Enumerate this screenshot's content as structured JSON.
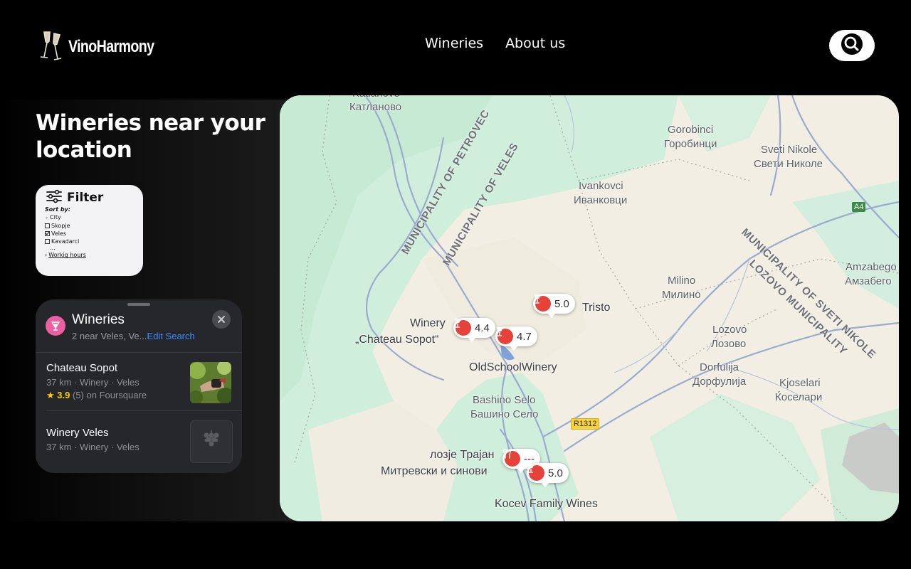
{
  "brand": {
    "name": "VinoHarmony"
  },
  "nav": {
    "items": [
      "Wineries",
      "About us"
    ]
  },
  "page": {
    "title": "Wineries near your location"
  },
  "filter": {
    "title": "Filter",
    "sort_by": "Sort by:",
    "city_label": "City",
    "cities": [
      {
        "name": "Skopje",
        "checked": false
      },
      {
        "name": "Veles",
        "checked": true
      },
      {
        "name": "Kavadarci",
        "checked": false
      }
    ],
    "ellipsis": "...",
    "hours_label": "Workig hours"
  },
  "wineries_panel": {
    "title": "Wineries",
    "subtitle": "2 near Veles, Ve...",
    "edit_label": "Edit Search",
    "results": [
      {
        "name": "Chateau Sopot",
        "meta": "37 km · Winery · Veles",
        "rating": "3.9",
        "rating_count": "(5)",
        "rating_source": "on Foursquare"
      },
      {
        "name": "Winery Veles",
        "meta": "37 km · Winery · Veles"
      }
    ]
  },
  "map": {
    "labels": {
      "katlanovo_lat": "Katlanovo",
      "katlanovo": "Катланово",
      "gorobinci_lat": "Gorobinci",
      "gorobinci": "Горобинци",
      "sveti_nikole_lat": "Sveti Nikole",
      "sveti_nikole": "Свети Николе",
      "ivankovci_lat": "Ivankovci",
      "ivankovci": "Иванковци",
      "amzabegovo_lat": "Amzabego",
      "amzabegovo": "Амзабего",
      "milino_lat": "Milino",
      "milino": "Милино",
      "tristo": "Tristo",
      "lozovo_lat": "Lozovo",
      "lozovo": "Лозово",
      "dorfulija_lat": "Dorfulija",
      "dorfulija": "Дорфулија",
      "kjoselari_lat": "Kjoselari",
      "kjoselari": "Ќоселари",
      "winery_chateau_1": "Winery",
      "winery_chateau_2": "„Chateau Sopot“",
      "oldschool": "OldSchoolWinery",
      "bashino_lat": "Bashino Selo",
      "bashino": "Башино Село",
      "lozje_1": "лозје Трајан",
      "lozje_2": "Митревски и синови",
      "kocev": "Kocev Family Wines"
    },
    "municipalities": {
      "petrovec": "MUNICIPALITY OF PETROVEC",
      "veles": "MUNICIPALITY OF VELES",
      "sveti_nikole": "MUNICIPALITY OF SVETI NIKOLE",
      "lozovo": "LOZOVO MUNICIPALITY"
    },
    "road_badges": {
      "a4": "A4",
      "r1312": "R1312"
    },
    "pins": [
      {
        "id": "tristo",
        "value": "5.0",
        "icon": "wine-glass-icon"
      },
      {
        "id": "chateau",
        "value": "4.4",
        "icon": "wine-glass-icon"
      },
      {
        "id": "oldschool",
        "value": "4.7",
        "icon": "wine-glass-icon"
      },
      {
        "id": "restaurant",
        "value": "---",
        "icon": "fork-knife-icon"
      },
      {
        "id": "kocev",
        "value": "5.0",
        "icon": "wine-glass-icon"
      }
    ],
    "colors": {
      "green": "#cfeedb",
      "land": "#f3eee3",
      "road": "#8a9ec6",
      "pin": "#e5433a"
    }
  }
}
